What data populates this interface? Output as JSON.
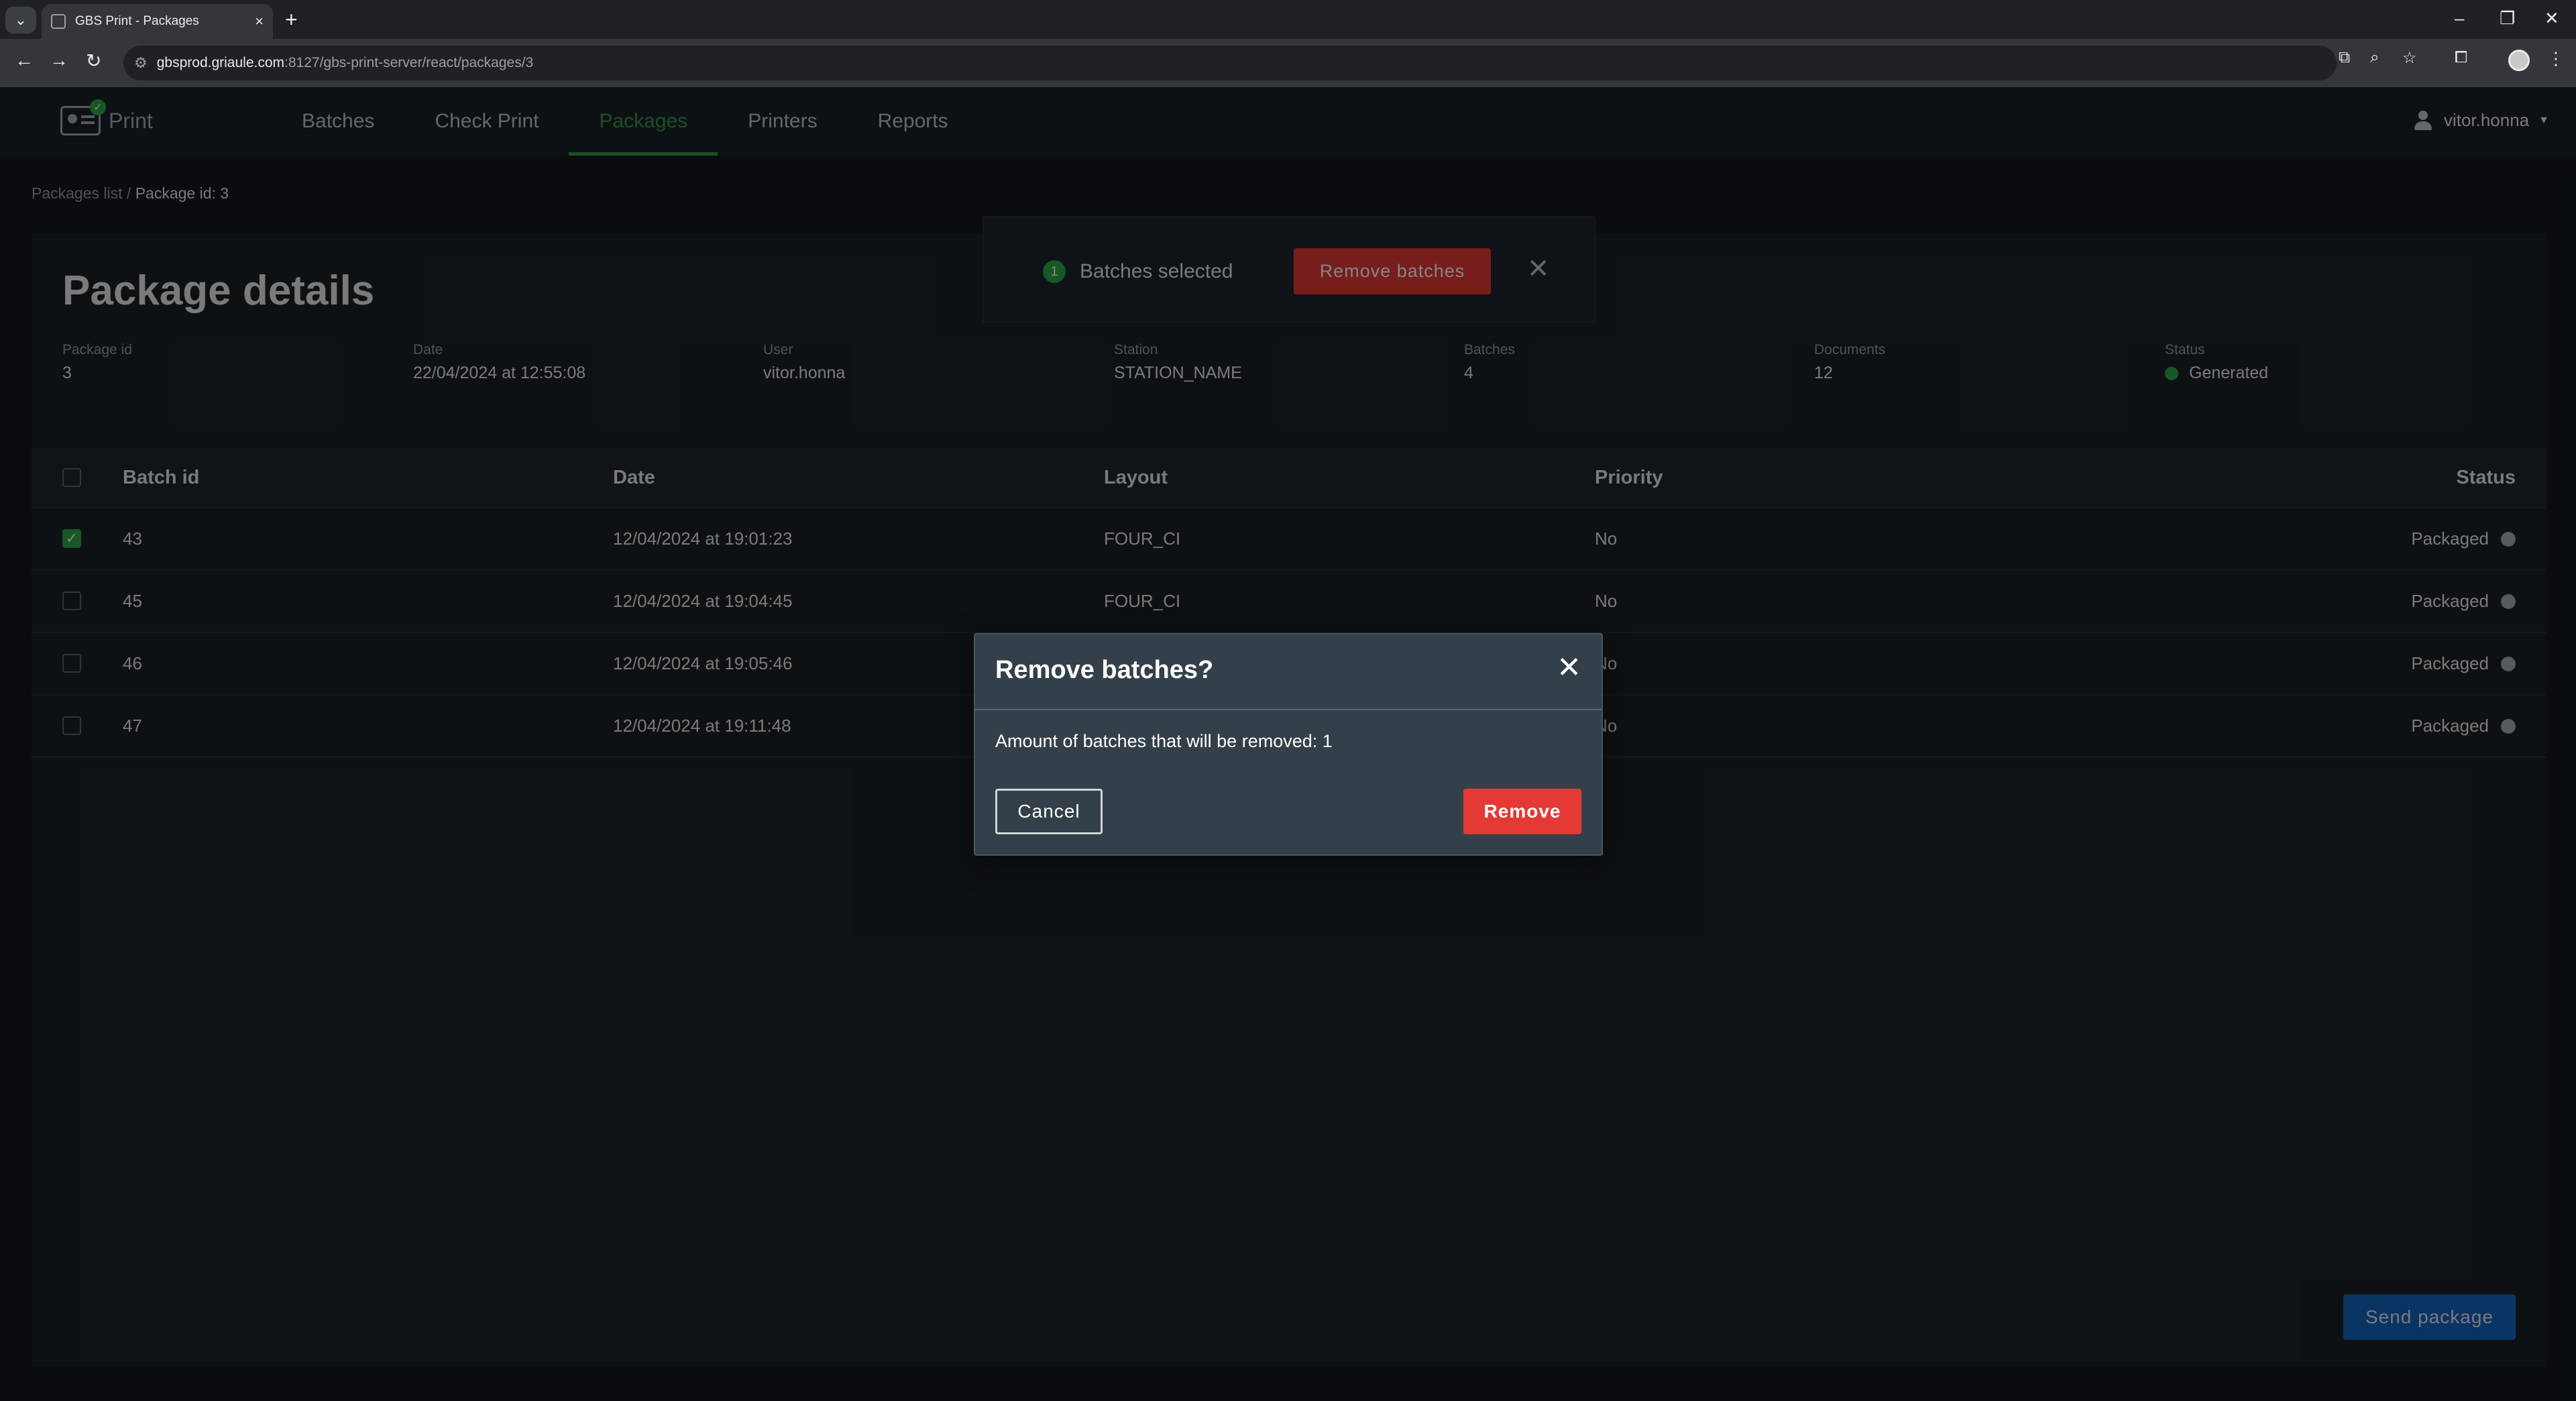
{
  "browser": {
    "tab_title": "GBS Print - Packages",
    "url_host": "gbsprod.griaule.com",
    "url_rest": ":8127/gbs-print-server/react/packages/3"
  },
  "app": {
    "logo_text": "Print",
    "nav": [
      "Batches",
      "Check Print",
      "Packages",
      "Printers",
      "Reports"
    ],
    "active_nav": "Packages",
    "user": "vitor.honna"
  },
  "breadcrumb": {
    "parent": "Packages list",
    "separator": " / ",
    "current": "Package id: 3"
  },
  "package": {
    "title": "Package details",
    "fields": [
      {
        "label": "Package id",
        "value": "3"
      },
      {
        "label": "Date",
        "value": "22/04/2024 at 12:55:08"
      },
      {
        "label": "User",
        "value": "vitor.honna"
      },
      {
        "label": "Station",
        "value": "STATION_NAME"
      },
      {
        "label": "Batches",
        "value": "4"
      },
      {
        "label": "Documents",
        "value": "12"
      },
      {
        "label": "Status",
        "value": "Generated"
      }
    ],
    "status_color": "#2ea84a"
  },
  "table": {
    "headers": {
      "batch_id": "Batch id",
      "date": "Date",
      "layout": "Layout",
      "priority": "Priority",
      "status": "Status"
    },
    "rows": [
      {
        "batch_id": "43",
        "date": "12/04/2024 at 19:01:23",
        "layout": "FOUR_CI",
        "priority": "No",
        "status": "Packaged",
        "checked": true
      },
      {
        "batch_id": "45",
        "date": "12/04/2024 at 19:04:45",
        "layout": "FOUR_CI",
        "priority": "No",
        "status": "Packaged",
        "checked": false
      },
      {
        "batch_id": "46",
        "date": "12/04/2024 at 19:05:46",
        "layout": "",
        "priority": "No",
        "status": "Packaged",
        "checked": false
      },
      {
        "batch_id": "47",
        "date": "12/04/2024 at 19:11:48",
        "layout": "",
        "priority": "No",
        "status": "Packaged",
        "checked": false
      }
    ]
  },
  "snackbar": {
    "count": "1",
    "text": "Batches selected",
    "button": "Remove batches"
  },
  "send_button": "Send package",
  "dialog": {
    "title": "Remove batches?",
    "body": "Amount of batches that will be removed: 1",
    "cancel": "Cancel",
    "confirm": "Remove"
  },
  "colors": {
    "accent_green": "#2f9c4a",
    "danger": "#e53935",
    "primary_blue": "#1565c0"
  }
}
